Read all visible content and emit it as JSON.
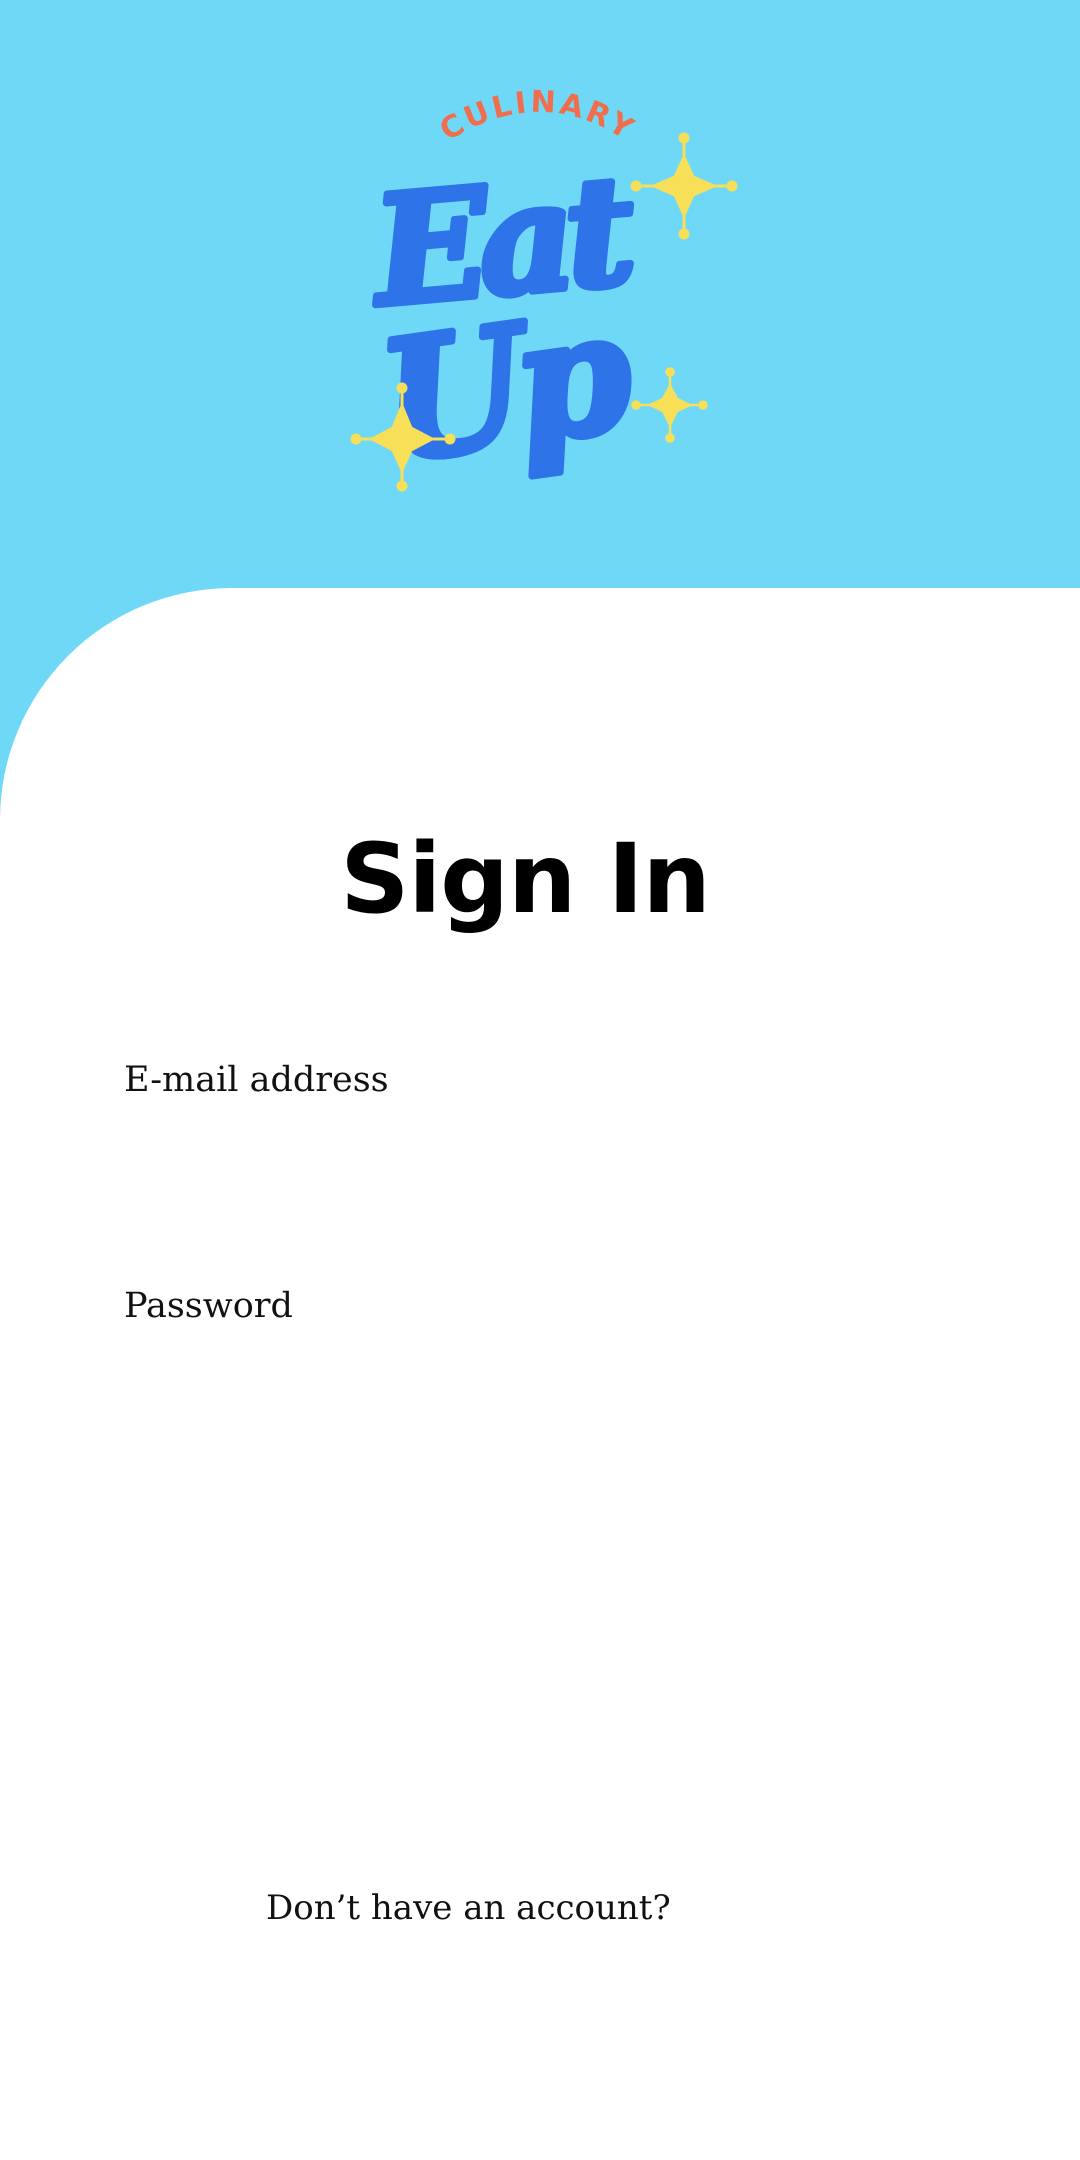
{
  "brand": {
    "tagline": "CULINARY",
    "name_line1": "Eat",
    "name_line2": "Up",
    "colors": {
      "sky": "#6fd8f7",
      "logo_text": "#2f73e8",
      "tagline": "#f26d4c",
      "sparkle": "#f7df57"
    },
    "icon": "sparkle-icon"
  },
  "page": {
    "title": "Sign In"
  },
  "form": {
    "email_label": "E-mail address",
    "email_value": "",
    "password_label": "Password",
    "password_value": ""
  },
  "footer": {
    "signup_prompt": "Don’t have an account?"
  }
}
